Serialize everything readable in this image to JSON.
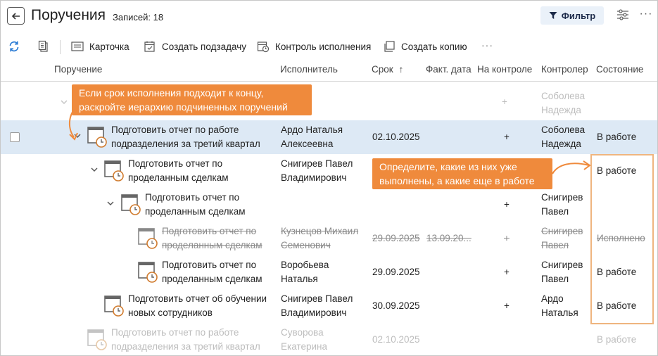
{
  "header": {
    "title": "Поручения",
    "records": "Записей: 18",
    "filter_label": "Фильтр"
  },
  "toolbar": {
    "card": "Карточка",
    "create_subtask": "Создать подзадачу",
    "execution_control": "Контроль исполнения",
    "create_copy": "Создать копию"
  },
  "columns": {
    "task": "Поручение",
    "executor": "Исполнитель",
    "deadline": "Срок",
    "actual_date": "Факт. дата",
    "on_control": "На контроле",
    "controller": "Контролер",
    "state": "Состояние"
  },
  "rows": [
    {
      "title1": "",
      "title2": "",
      "executor1": "",
      "executor2": "",
      "deadline": "",
      "actual": "",
      "control": "+",
      "controller1": "Соболева",
      "controller2": "Надежда",
      "state": ""
    },
    {
      "title1": "Подготовить отчет по работе",
      "title2": "подразделения за третий квартал",
      "executor1": "Ардо Наталья",
      "executor2": "Алексеевна",
      "deadline": "02.10.2025",
      "actual": "",
      "control": "+",
      "controller1": "Соболева",
      "controller2": "Надежда",
      "state": "В работе"
    },
    {
      "title1": "Подготовить отчет по",
      "title2": "проделанным сделкам",
      "executor1": "Снигирев Павел",
      "executor2": "Владимирович",
      "deadline": "",
      "actual": "",
      "control": "",
      "controller1": "",
      "controller2": "",
      "state": "В работе"
    },
    {
      "title1": "Подготовить отчет по",
      "title2": "проделанным сделкам",
      "executor1": "",
      "executor2": "",
      "deadline": "",
      "actual": "",
      "control": "+",
      "controller1": "Снигирев",
      "controller2": "Павел",
      "state": ""
    },
    {
      "title1": "Подготовить отчет по",
      "title2": "проделанным сделкам",
      "executor1": "Кузнецов Михаил",
      "executor2": "Семенович",
      "deadline": "29.09.2025",
      "actual": "13.09.20...",
      "control": "+",
      "controller1": "Снигирев",
      "controller2": "Павел",
      "state": "Исполнено"
    },
    {
      "title1": "Подготовить отчет по",
      "title2": "проделанным сделкам",
      "executor1": "Воробьева",
      "executor2": "Наталья",
      "deadline": "29.09.2025",
      "actual": "",
      "control": "+",
      "controller1": "Снигирев",
      "controller2": "Павел",
      "state": "В работе"
    },
    {
      "title1": "Подготовить отчет об обучении",
      "title2": "новых сотрудников",
      "executor1": "Снигирев Павел",
      "executor2": "Владимирович",
      "deadline": "30.09.2025",
      "actual": "",
      "control": "+",
      "controller1": "Ардо",
      "controller2": "Наталья",
      "state": "В работе"
    },
    {
      "title1": "Подготовить отчет по работе",
      "title2": "подразделения за третий квартал",
      "executor1": "Суворова",
      "executor2": "Екатерина",
      "deadline": "02.10.2025",
      "actual": "",
      "control": "",
      "controller1": "",
      "controller2": "",
      "state": "В работе"
    }
  ],
  "callouts": {
    "first_line1": "Если срок исполнения подходит к концу,",
    "first_line2": "раскройте иерархию подчиненных поручений",
    "second_line1": "Определите, какие из них уже",
    "second_line2": "выполнены, а какие еще в работе"
  },
  "colors": {
    "accent_orange": "#ef8a3c",
    "selected_row": "#dde9f5",
    "icon_blue": "#2a7bd4"
  }
}
